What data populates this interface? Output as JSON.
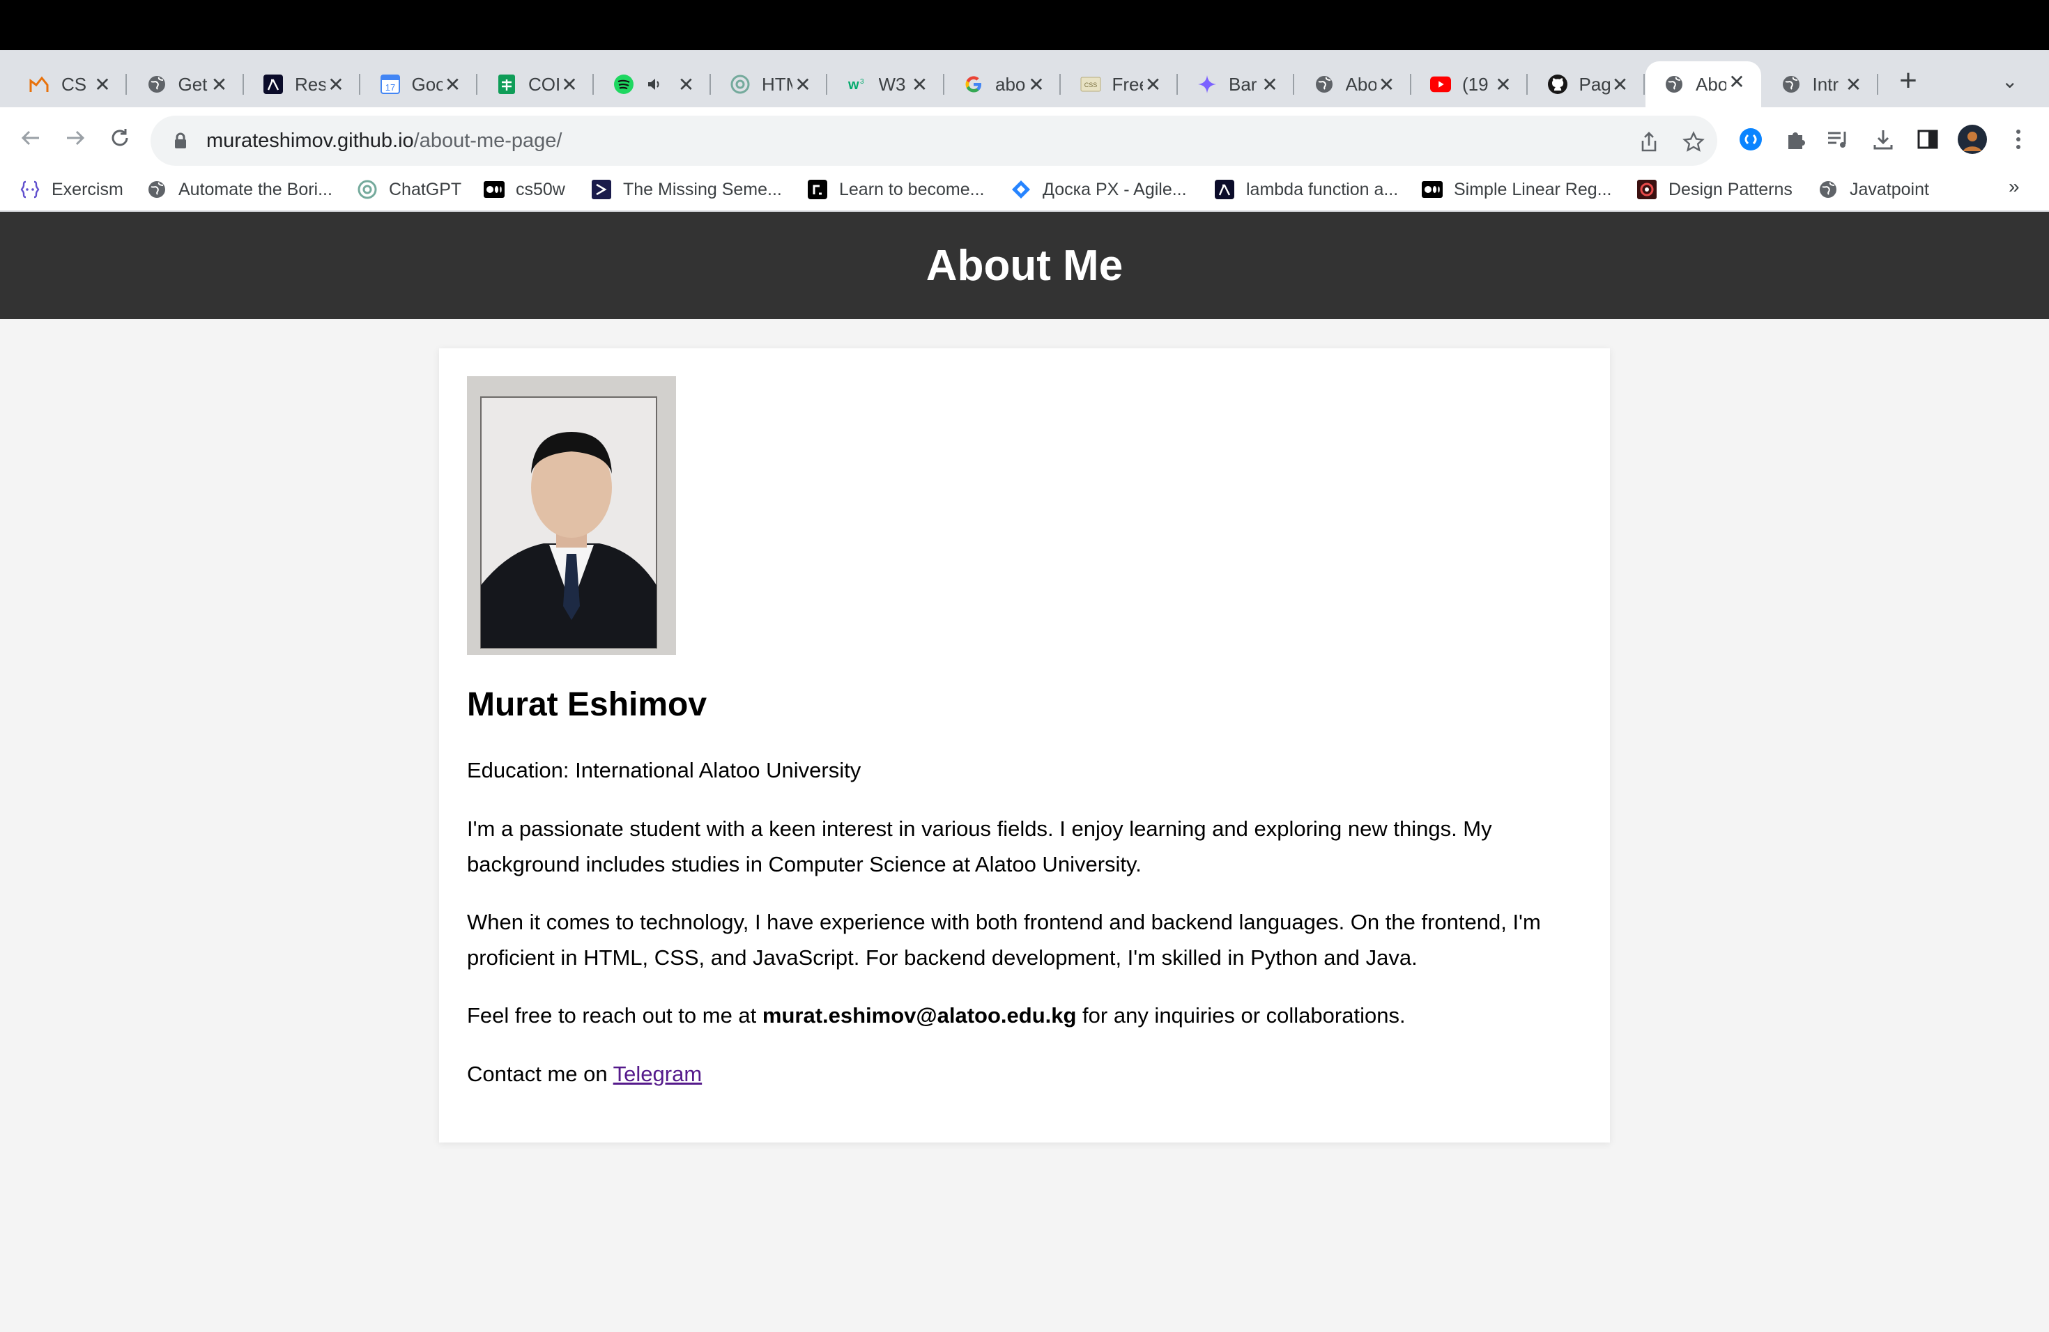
{
  "browser": {
    "tabs": [
      {
        "title": "CS",
        "icon": "courseraish-icon"
      },
      {
        "title": "Get",
        "icon": "globe-icon"
      },
      {
        "title": "Res",
        "icon": "lambda-icon"
      },
      {
        "title": "Goo",
        "icon": "calendar-icon"
      },
      {
        "title": "COI",
        "icon": "sheets-icon"
      },
      {
        "title": "",
        "icon": "spotify-icon",
        "muted_icon": "speaker-icon"
      },
      {
        "title": "HTM",
        "icon": "chatgpt-icon"
      },
      {
        "title": "W3",
        "icon": "w3schools-icon"
      },
      {
        "title": "abo",
        "icon": "google-icon"
      },
      {
        "title": "Free",
        "icon": "css-icon"
      },
      {
        "title": "Bar",
        "icon": "bard-icon"
      },
      {
        "title": "Abo",
        "icon": "globe-icon"
      },
      {
        "title": "(19",
        "icon": "youtube-icon"
      },
      {
        "title": "Pag",
        "icon": "github-icon"
      },
      {
        "title": "Abo",
        "icon": "globe-icon",
        "active": true
      },
      {
        "title": "Intr",
        "icon": "globe-icon"
      }
    ],
    "address": {
      "domain": "murateshimov.github.io",
      "path": "/about-me-page/"
    },
    "bookmarks": [
      {
        "label": "Exercism",
        "icon": "exercism-icon"
      },
      {
        "label": "Automate the Bori...",
        "icon": "globe-icon"
      },
      {
        "label": "ChatGPT",
        "icon": "chatgpt-icon"
      },
      {
        "label": "cs50w",
        "icon": "medium-icon"
      },
      {
        "label": "The Missing Seme...",
        "icon": "terminal-icon"
      },
      {
        "label": "Learn to become...",
        "icon": "roadmap-icon"
      },
      {
        "label": "Доска PX - Agile...",
        "icon": "jira-icon"
      },
      {
        "label": "lambda function a...",
        "icon": "lambda-icon"
      },
      {
        "label": "Simple Linear Reg...",
        "icon": "medium-icon"
      },
      {
        "label": "Design Patterns",
        "icon": "refactoring-icon"
      },
      {
        "label": "Javatpoint",
        "icon": "globe-icon"
      }
    ],
    "colors": {
      "header_bg": "#333333",
      "page_bg": "#f4f4f4",
      "link": "#551a8b"
    }
  },
  "page": {
    "header_title": "About Me",
    "name": "Murat Eshimov",
    "education": "Education: International Alatoo University",
    "bio1": "I'm a passionate student with a keen interest in various fields. I enjoy learning and exploring new things. My background includes studies in Computer Science at Alatoo University.",
    "bio2": "When it comes to technology, I have experience with both frontend and backend languages. On the frontend, I'm proficient in HTML, CSS, and JavaScript. For backend development, I'm skilled in Python and Java.",
    "contact_prefix": "Feel free to reach out to me at ",
    "email": "murat.eshimov@alatoo.edu.kg",
    "contact_suffix": " for any inquiries or collaborations.",
    "telegram_prefix": "Contact me on ",
    "telegram_link": "Telegram"
  }
}
